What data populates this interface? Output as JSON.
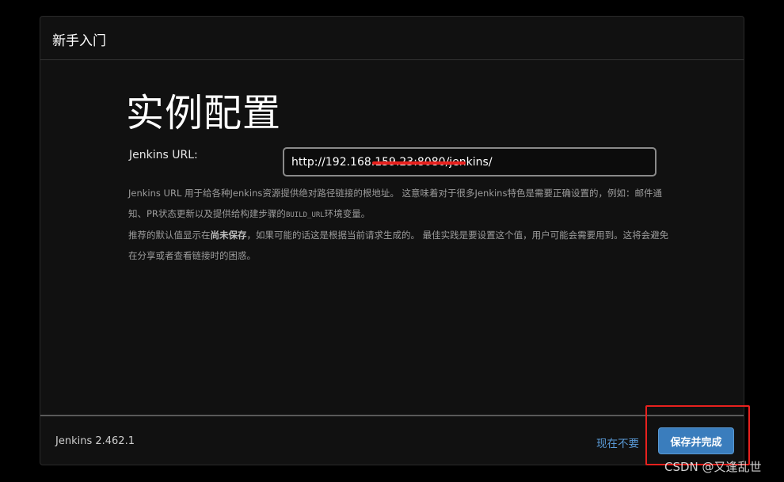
{
  "dialog": {
    "title": "新手入门"
  },
  "page": {
    "heading": "实例配置"
  },
  "form": {
    "url_label": "Jenkins URL:",
    "url_value": "http://192.168.159.23:8080/jenkins/"
  },
  "help": {
    "p1_text": "Jenkins URL 用于给各种Jenkins资源提供绝对路径链接的根地址。 这意味着对于很多Jenkins特色是需要正确设置的，例如：邮件通知、PR状态更新以及提供给构建步骤的",
    "p1_code": "BUILD_URL",
    "p1_tail": "环境变量。",
    "p2_prefix": "推荐的默认值显示在",
    "p2_strong": "尚未保存",
    "p2_suffix": "，如果可能的话这是根据当前请求生成的。 最佳实践是要设置这个值，用户可能会需要用到。这将会避免在分享或者查看链接时的困惑。"
  },
  "footer": {
    "version": "Jenkins 2.462.1",
    "skip_label": "现在不要",
    "save_label": "保存并完成"
  },
  "watermark": {
    "text": "CSDN @又逢乱世"
  },
  "colors": {
    "background": "#000000",
    "panel": "#111111",
    "link": "#5a9bd8",
    "primary_button": "#3a7dbd",
    "annotation_red": "#e8211e"
  }
}
